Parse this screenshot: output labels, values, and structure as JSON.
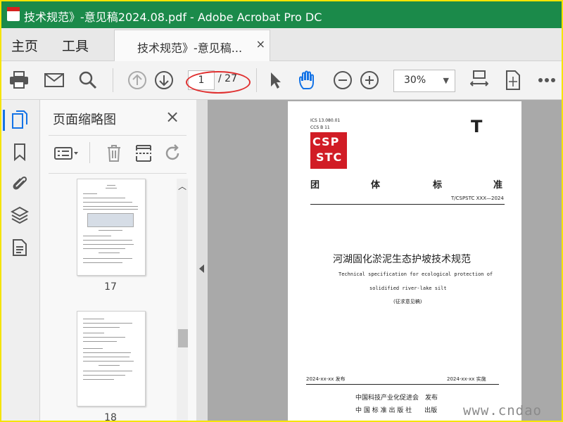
{
  "window": {
    "title": "技术规范》-意见稿2024.08.pdf - Adobe Acrobat Pro DC"
  },
  "tabs": {
    "home": "主页",
    "tools": "工具",
    "document": "技术规范》-意见稿...",
    "close": "×"
  },
  "toolbar": {
    "page_current": "1",
    "page_total": "/ 27",
    "zoom": "30%"
  },
  "thumbnails_panel": {
    "title": "页面缩略图",
    "close": "×",
    "pages": [
      "17",
      "18"
    ]
  },
  "document_page": {
    "ics": "ICS 13.080.01",
    "ccs": "CCS B 11",
    "big_letter": "T",
    "logo_top": "CSP",
    "logo_bottom": "STC",
    "standard_type": [
      "团",
      "体",
      "标",
      "准"
    ],
    "code": "T/CSPSTC XXX—2024",
    "title_cn": "河湖固化淤泥生态护坡技术规范",
    "title_en_1": "Technical specification for ecological protection of",
    "title_en_2": "solidified river-lake silt",
    "draft": "(征求意见稿)",
    "publish_date": "2024-xx-xx  发布",
    "implement_date": "2024-xx-xx  实施",
    "issuer_1": "中国科技产业化促进会　发布",
    "issuer_2": "中 国 标 准 出 版 社　　出版"
  },
  "watermark": "www.cndao",
  "colors": {
    "titlebar": "#1b8a4a",
    "frame": "#f5e400",
    "accent_blue": "#1473e6",
    "annotation_red": "#e03030",
    "logo_red": "#d11c25"
  }
}
